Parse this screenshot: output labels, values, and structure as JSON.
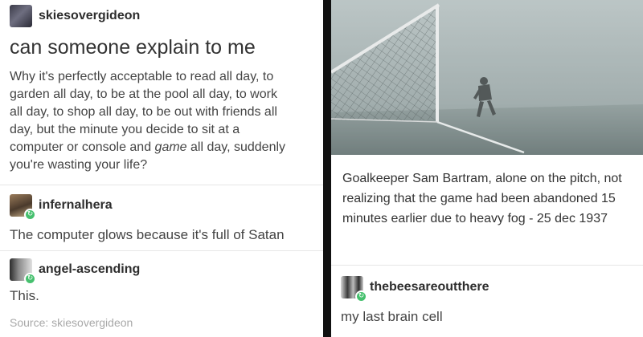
{
  "left_panel": {
    "op": {
      "username": "skiesovergideon",
      "title": "can someone explain to me",
      "body_lines": [
        "Why it's perfectly acceptable to read all day, to",
        "garden all day, to be at the pool all day, to work",
        "all day, to shop all day, to be out with friends all",
        "day, but the minute you decide to sit at a",
        "computer or console and ",
        "game",
        " all day, suddenly",
        "you're wasting your life?"
      ]
    },
    "reply1": {
      "username": "infernalhera",
      "text": "The computer glows because it's full of Satan"
    },
    "reply2": {
      "username": "angel-ascending",
      "text": "This."
    },
    "source": "Source: skiesovergideon"
  },
  "right_panel": {
    "photo_icon": "goal-in-fog-photo",
    "caption": "Goalkeeper Sam Bartram, alone on the pitch, not realizing that the game had been abandoned 15 minutes earlier due to heavy fog - 25 dec 1937",
    "reply": {
      "username": "thebeesareoutthere",
      "text": "my last brain cell"
    }
  },
  "colors": {
    "reblog_badge": "#46c06e",
    "text_dark": "#333333",
    "text_muted": "#a8a8a8"
  }
}
